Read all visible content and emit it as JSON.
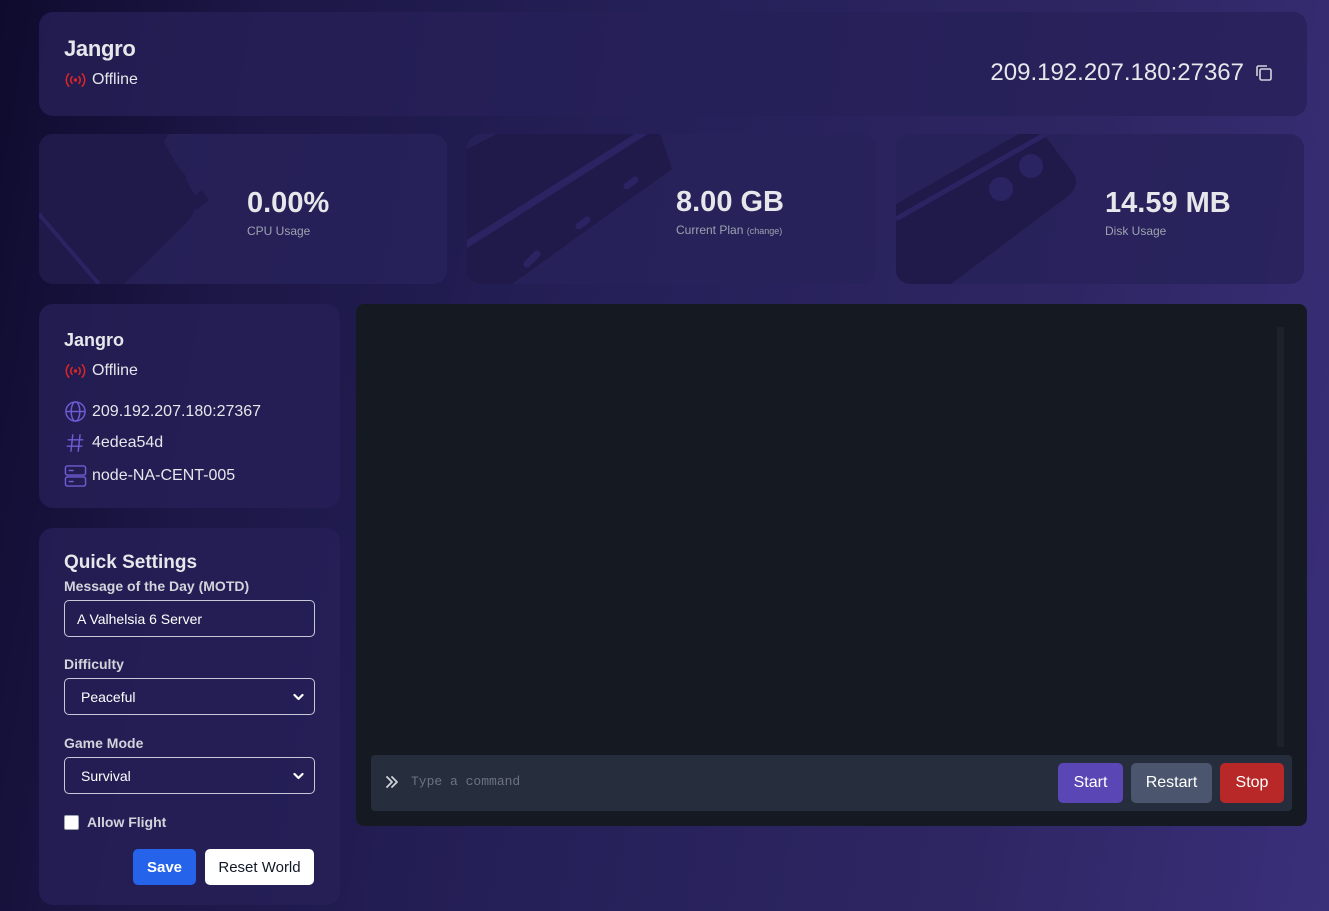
{
  "header": {
    "server_name": "Jangro",
    "status": "Offline",
    "address": "209.192.207.180:27367"
  },
  "stats": {
    "cpu": {
      "value": "0.00%",
      "label": "CPU Usage"
    },
    "plan": {
      "value": "8.00 GB",
      "label": "Current Plan",
      "change_link": "(change)"
    },
    "disk": {
      "value": "14.59 MB",
      "label": "Disk Usage"
    }
  },
  "info": {
    "server_name": "Jangro",
    "status": "Offline",
    "address": "209.192.207.180:27367",
    "id": "4edea54d",
    "node": "node-NA-CENT-005"
  },
  "quick_settings": {
    "title": "Quick Settings",
    "motd_label": "Message of the Day (MOTD)",
    "motd_value": "A Valhelsia 6 Server",
    "difficulty_label": "Difficulty",
    "difficulty_value": "Peaceful",
    "gamemode_label": "Game Mode",
    "gamemode_value": "Survival",
    "allow_flight_label": "Allow Flight",
    "allow_flight_checked": false,
    "save_label": "Save",
    "reset_label": "Reset World"
  },
  "console": {
    "input_placeholder": "Type a command",
    "start_label": "Start",
    "restart_label": "Restart",
    "stop_label": "Stop"
  },
  "colors": {
    "accent": "#6d5dd3",
    "status_offline": "#dc2626",
    "start": "#5b46b5",
    "restart": "#4b566e",
    "stop": "#b82828",
    "save": "#2563eb"
  },
  "icons": {
    "status": "broadcast-icon",
    "copy": "copy-icon",
    "address": "globe-icon",
    "id": "hash-icon",
    "node": "server-icon",
    "prompt": "chevrons-right-icon",
    "select": "chevron-down-icon"
  }
}
